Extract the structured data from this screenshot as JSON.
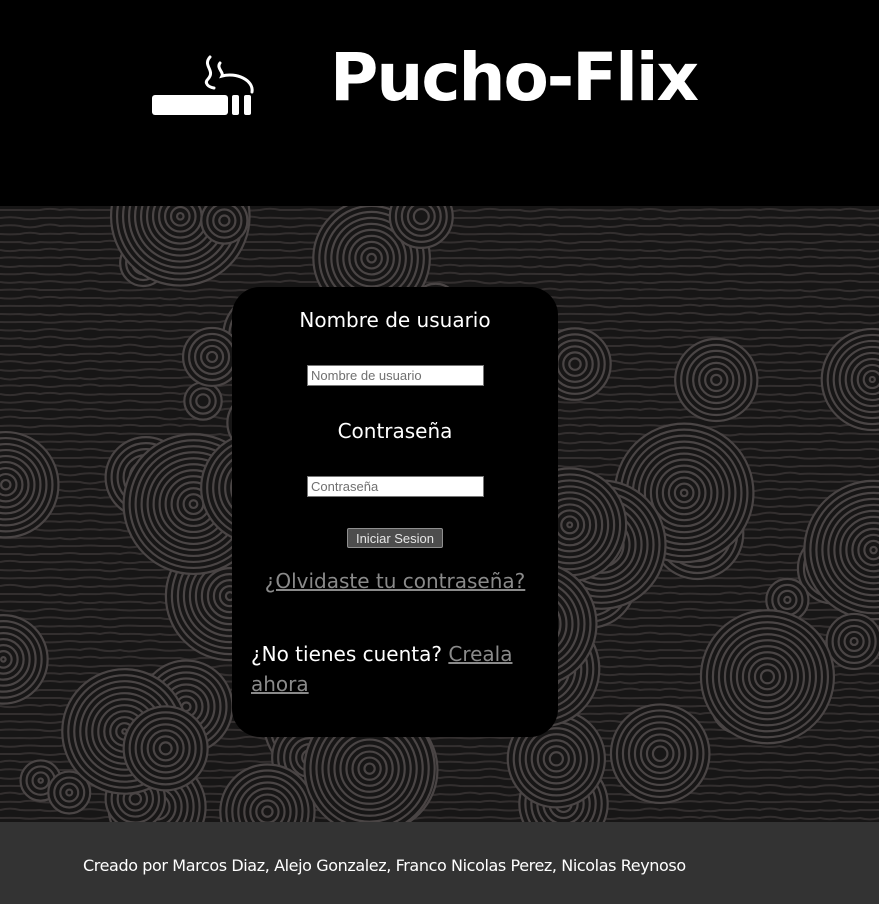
{
  "header": {
    "logo_icon": "smoking-cigarette-icon",
    "title": "Pucho-Flix"
  },
  "login": {
    "username_label": "Nombre de usuario",
    "username_placeholder": "Nombre de usuario",
    "username_value": "",
    "password_label": "Contraseña",
    "password_placeholder": "Contraseña",
    "password_value": "",
    "submit_label": "Iniciar Sesion",
    "forgot_link": "¿Olvidaste tu contraseña?",
    "no_account_text": "¿No tienes cuenta?",
    "signup_link": "Creala ahora"
  },
  "footer": {
    "credits": "Creado por Marcos Diaz, Alejo Gonzalez, Franco Nicolas Perez, Nicolas Reynoso"
  },
  "colors": {
    "background": "#000000",
    "pattern_base": "#171616",
    "pattern_rings": "#4a4545",
    "link": "#8a8a8a",
    "footer": "#333333",
    "text": "#ffffff"
  }
}
